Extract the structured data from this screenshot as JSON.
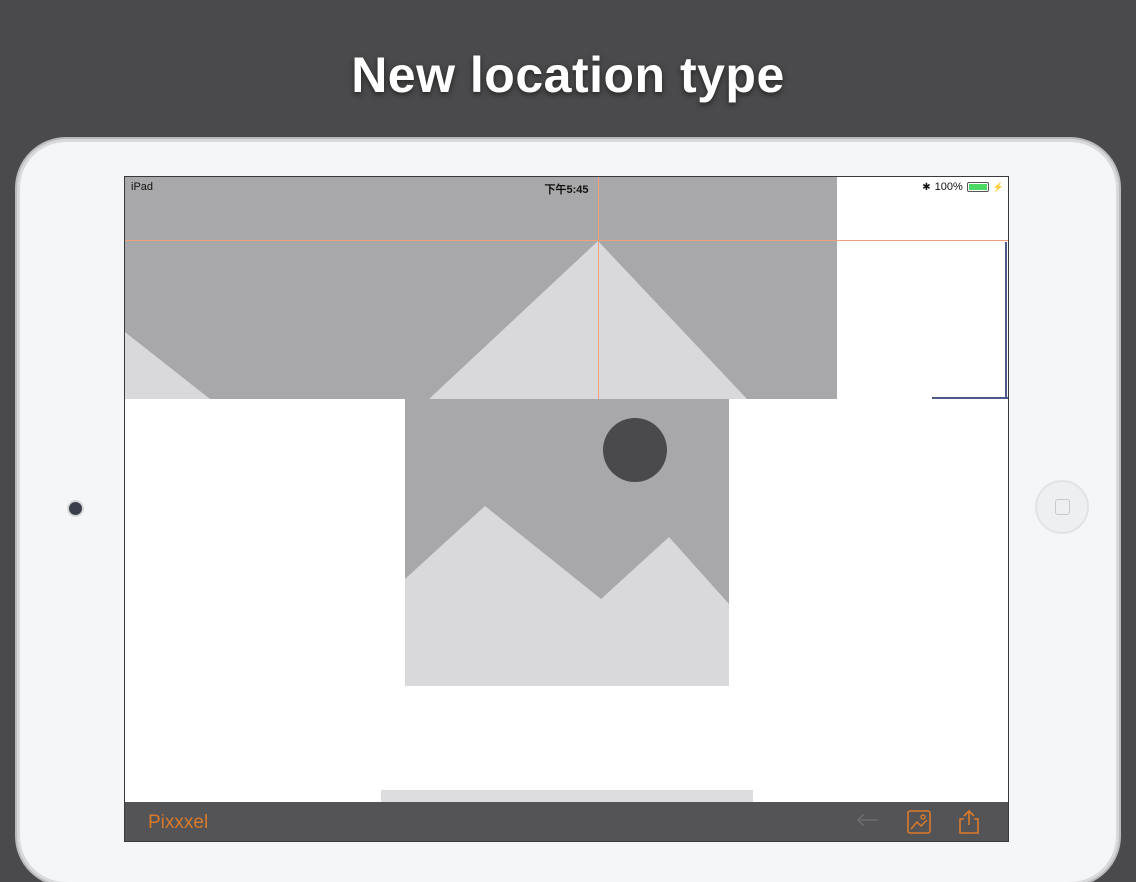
{
  "headline": "New location type",
  "status_bar": {
    "device": "iPad",
    "time": "下午5:45",
    "battery": "100%"
  },
  "toolbar": {
    "app_title": "Pixxxel"
  },
  "icons": [
    "back-arrow-icon",
    "gallery-icon",
    "share-icon",
    "bluetooth-icon",
    "battery-icon",
    "charging-icon",
    "camera",
    "home-button"
  ],
  "colors": {
    "background": "#4a494b",
    "accent": "#d97a2b",
    "guide": "#f0a07a",
    "toolbar": "#545356",
    "placeholder": "#a8a7a9",
    "mountain": "#d9d8da",
    "sun": "#4a494b"
  }
}
